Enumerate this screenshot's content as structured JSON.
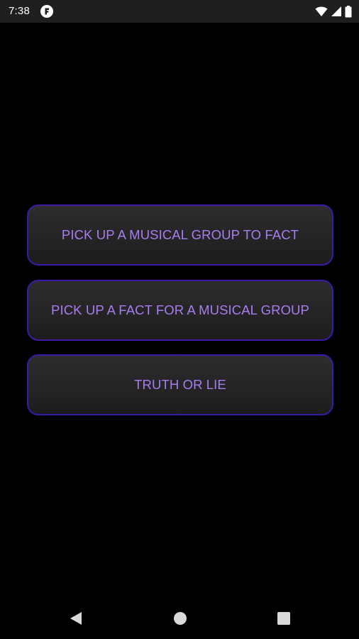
{
  "status_bar": {
    "time": "7:38",
    "app_icon": "app-notification-icon",
    "icons": [
      "wifi-icon",
      "signal-icon",
      "battery-icon"
    ]
  },
  "menu": {
    "buttons": [
      {
        "label": "PICK UP A MUSICAL GROUP TO FACT"
      },
      {
        "label": "PICK UP A FACT FOR A MUSICAL GROUP"
      },
      {
        "label": "TRUTH OR LIE"
      }
    ]
  },
  "nav_bar": {
    "icons": [
      "back-icon",
      "home-icon",
      "recents-icon"
    ]
  },
  "colors": {
    "background": "#000000",
    "button_border": "#3b1aa8",
    "button_text": "#a77df0",
    "status_bar": "#1f1f1f"
  }
}
